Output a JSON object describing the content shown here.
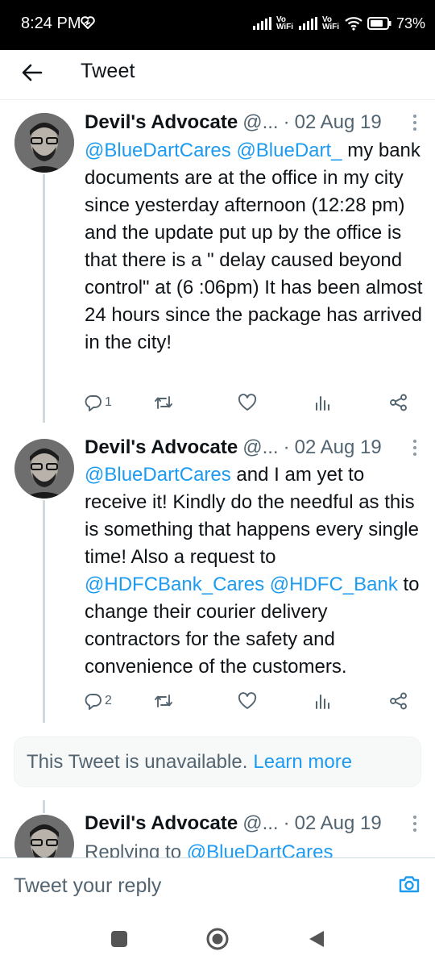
{
  "status_bar": {
    "time": "8:24 PM",
    "network_label_1": "Vo WiFi",
    "network_label_2": "Vo WiFi",
    "battery": "73%"
  },
  "header": {
    "title": "Tweet",
    "back_icon": "arrow-left-icon"
  },
  "tweets": [
    {
      "name": "Devil's Advocate",
      "handle": "@...",
      "separator": "·",
      "date": "02 Aug 19",
      "text_parts": [
        {
          "text": "@BlueDartCares",
          "mention": true
        },
        {
          "text": " ",
          "mention": false
        },
        {
          "text": "@BlueDart_",
          "mention": true
        },
        {
          "text": " my bank documents are at the office in my city since yesterday afternoon (12:28 pm) and the update put up by the office is that there is a \" delay caused beyond control\" at (6 :06pm) It has been almost 24 hours since the package has arrived in the city!",
          "mention": false
        }
      ],
      "reply_count": "1"
    },
    {
      "name": "Devil's Advocate",
      "handle": "@...",
      "separator": "·",
      "date": "02 Aug 19",
      "text_parts": [
        {
          "text": "@BlueDartCares",
          "mention": true
        },
        {
          "text": " and I am yet to receive it! Kindly do the needful as this is something that happens every single time! Also a request to ",
          "mention": false
        },
        {
          "text": "@HDFCBank_Cares",
          "mention": true
        },
        {
          "text": " ",
          "mention": false
        },
        {
          "text": "@HDFC_Bank",
          "mention": true
        },
        {
          "text": " to change their courier delivery contractors for the safety and convenience of the customers.",
          "mention": false
        }
      ],
      "reply_count": "2"
    },
    {
      "name": "Devil's Advocate",
      "handle": "@...",
      "separator": "·",
      "date": "02 Aug 19",
      "replying_prefix": "Replying to ",
      "replying_to": "@BlueDartCares"
    }
  ],
  "unavailable": {
    "message": "This Tweet is unavailable.",
    "link": "Learn more"
  },
  "reply_bar": {
    "placeholder": "Tweet your reply"
  },
  "colors": {
    "accent": "#1d9bf0",
    "text": "#0f1419",
    "secondary": "#536471"
  }
}
